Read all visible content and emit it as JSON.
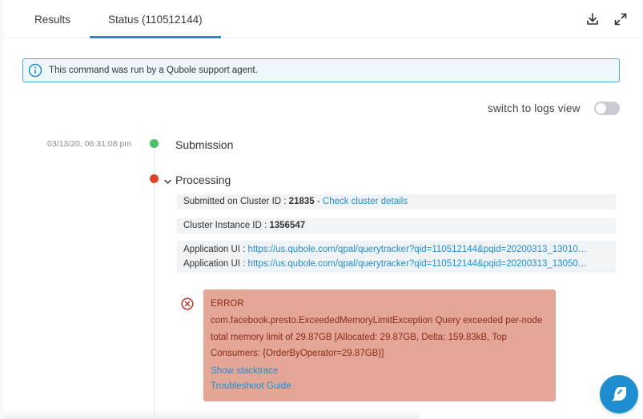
{
  "tabs": {
    "results_label": "Results",
    "status_label": "Status (110512144)"
  },
  "toolbar": {
    "download_icon": "download-icon",
    "expand_icon": "expand-icon"
  },
  "banner": {
    "text": "This command was run by a Qubole support agent.",
    "icon": "info-icon"
  },
  "view_switch": {
    "label": "switch to logs view",
    "on": false
  },
  "timeline": {
    "submission": {
      "timestamp": "03/13/20, 06:31:08 pm",
      "title": "Submission",
      "status_color": "#4cc265"
    },
    "processing": {
      "title": "Processing",
      "status_color": "#e0452b",
      "cluster": {
        "prefix": "Submitted on Cluster ID : ",
        "id": "21835",
        "separator": " - ",
        "link": "Check cluster details"
      },
      "instance": {
        "prefix": "Cluster Instance ID : ",
        "id": "1356547"
      },
      "app_ui": [
        {
          "prefix": "Application UI : ",
          "url": "https://us.qubole.com/qpal/querytracker?qid=110512144&pqid=20200313_13010…"
        },
        {
          "prefix": "Application UI : ",
          "url": "https://us.qubole.com/qpal/querytracker?qid=110512144&pqid=20200313_13050…"
        }
      ],
      "error": {
        "title": "ERROR",
        "message": "com.facebook.presto.ExceededMemoryLimitException Query exceeded per-node total memory limit of 29.87GB [Allocated: 29.87GB, Delta: 159.83kB, Top Consumers: {OrderByOperator=29.87GB}]",
        "stacktrace_link": "Show stacktrace",
        "guide_link": "Troubleshoot Guide"
      }
    }
  },
  "help_button": {
    "icon": "chat-bubble-icon"
  },
  "colors": {
    "accent": "#1f8ed1",
    "error_bg": "#e4a797",
    "error_text": "#8a2a18",
    "success": "#4cc265",
    "danger": "#e0452b"
  }
}
